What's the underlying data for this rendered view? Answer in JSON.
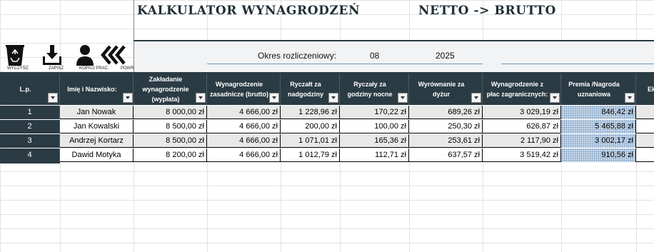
{
  "header": {
    "title": "KALKULATOR WYNAGRODZEŃ",
    "mode": "NETTO -> BRUTTO"
  },
  "toolbar": {
    "clear_label": "WYCZYŚĆ",
    "save_label": "ZAPISZ",
    "copy_label": "KOPIUJ PRAC.",
    "back_label": "POWR"
  },
  "period": {
    "label": "Okres rozliczeniowy:",
    "month": "08",
    "year": "2025"
  },
  "table": {
    "columns": [
      "L.p.",
      "Imię i Nazwisko:",
      "Zakładanie wynagrodzenie (wypłata)",
      "Wynagrodzenie zasadnicze (brutto)",
      "Ryczałt za nadgodziny",
      "Ryczały za godziny nocne",
      "Wyrównanie za dyżur",
      "Wynagrodzenie z płac zagranicznych:",
      "Premia /Nagroda uznaniowa",
      "Ek"
    ],
    "rows": [
      {
        "lp": "1",
        "name": "Jan Nowak",
        "target": "8 000,00 zł",
        "base": "4 666,00 zł",
        "overtime": "1 228,96 zł",
        "night": "170,22 zł",
        "duty": "689,26 zł",
        "foreign": "3 029,19 zł",
        "bonus": "846,42 zł"
      },
      {
        "lp": "2",
        "name": "Jan Kowalski",
        "target": "8 500,00 zł",
        "base": "4 666,00 zł",
        "overtime": "200,00 zł",
        "night": "100,00 zł",
        "duty": "250,30 zł",
        "foreign": "626,87 zł",
        "bonus": "5 465,88 zł"
      },
      {
        "lp": "3",
        "name": "Andrzej Kortarz",
        "target": "8 500,00 zł",
        "base": "4 666,00 zł",
        "overtime": "1 071,01 zł",
        "night": "165,36 zł",
        "duty": "253,61 zł",
        "foreign": "2 117,90 zł",
        "bonus": "3 002,17 zł"
      },
      {
        "lp": "4",
        "name": "Dawid Motyka",
        "target": "8 200,00 zł",
        "base": "4 666,00 zł",
        "overtime": "1 012,79 zł",
        "night": "112,71 zł",
        "duty": "637,57 zł",
        "foreign": "3 519,42 zł",
        "bonus": "910,56 zł"
      }
    ]
  },
  "colors": {
    "header_dark": "#2b3b44",
    "title_text": "#1f2e36",
    "bonus_fill": "#c9d9ea"
  }
}
